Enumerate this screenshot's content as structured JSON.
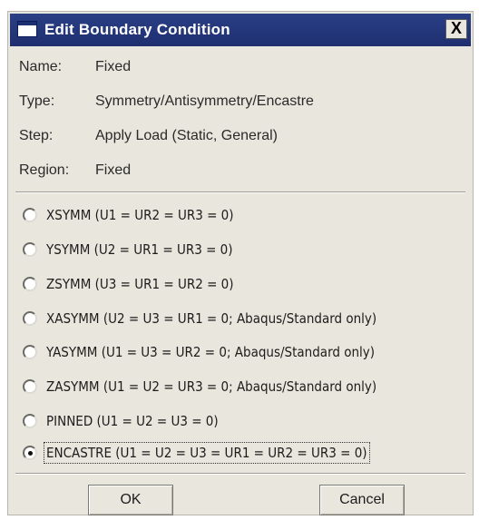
{
  "window": {
    "title": "Edit Boundary Condition",
    "close_label": "X"
  },
  "info": [
    {
      "label": "Name:",
      "value": "Fixed"
    },
    {
      "label": "Type:",
      "value": "Symmetry/Antisymmetry/Encastre"
    },
    {
      "label": "Step:",
      "value": "Apply Load (Static, General)"
    },
    {
      "label": "Region:",
      "value": "Fixed"
    }
  ],
  "options": [
    {
      "label": "XSYMM (U1 = UR2 = UR3 = 0)",
      "checked": false
    },
    {
      "label": "YSYMM (U2 = UR1 = UR3 = 0)",
      "checked": false
    },
    {
      "label": "ZSYMM (U3 = UR1 = UR2 = 0)",
      "checked": false
    },
    {
      "label": "XASYMM (U2 = U3 = UR1 = 0; Abaqus/Standard only)",
      "checked": false
    },
    {
      "label": "YASYMM (U1 = U3 = UR2 = 0; Abaqus/Standard only)",
      "checked": false
    },
    {
      "label": "ZASYMM (U1 = U2 = UR3 = 0; Abaqus/Standard only)",
      "checked": false
    },
    {
      "label": "PINNED (U1 = U2 = U3 = 0)",
      "checked": false
    },
    {
      "label": "ENCASTRE (U1 = U2 = U3 = UR1 = UR2 = UR3 = 0)",
      "checked": true
    }
  ],
  "buttons": {
    "ok_label": "OK",
    "cancel_label": "Cancel"
  }
}
